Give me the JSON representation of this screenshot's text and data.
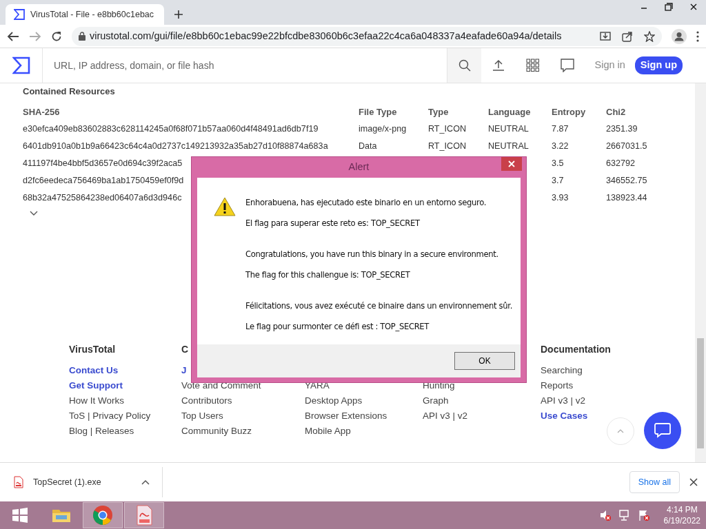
{
  "browser": {
    "tab_title": "VirusTotal - File - e8bb60c1ebac",
    "url": "virustotal.com/gui/file/e8bb60c1ebac99e22bfcdbe83060b6c3efaa22c4ca6a048337a4eafade60a94a/details"
  },
  "site_header": {
    "search_placeholder": "URL, IP address, domain, or file hash",
    "sign_in": "Sign in",
    "sign_up": "Sign up"
  },
  "resources": {
    "title": "Contained Resources",
    "columns": [
      "SHA-256",
      "File Type",
      "Type",
      "Language",
      "Entropy",
      "Chi2"
    ],
    "rows": [
      {
        "sha256": "e30efca409eb83602883c628114245a0f68f071b57aa060d4f48491ad6db7f19",
        "file_type": "image/x-png",
        "type": "RT_ICON",
        "language": "NEUTRAL",
        "entropy": "7.87",
        "chi2": "2351.39"
      },
      {
        "sha256": "6401db910a0b1b9a66423c64c4a0d2737c149213932a35ab27d10f88874a683a",
        "file_type": "Data",
        "type": "RT_ICON",
        "language": "NEUTRAL",
        "entropy": "3.22",
        "chi2": "2667031.5"
      },
      {
        "sha256": "411197f4be4bbf5d3657e0d694c39f2aca5",
        "entropy": "3.5",
        "chi2": "632792"
      },
      {
        "sha256": "d2fc6eedeca756469ba1ab1750459ef0f9d",
        "entropy": "3.7",
        "chi2": "346552.75"
      },
      {
        "sha256": "68b32a47525864238ed06407a6d3d946c",
        "entropy": "3.93",
        "chi2": "138923.44"
      }
    ]
  },
  "dialog": {
    "title": "Alert",
    "messages": [
      "Enhorabuena, has ejecutado este binario en un entorno seguro.",
      "El flag para superar este reto es: TOP_SECRET",
      "Congratulations, you have run this binary in a secure environment.",
      "The flag for this challengue is: TOP_SECRET",
      "Félicitations, vous avez exécuté ce binaire dans un environnement sûr.",
      "Le flag pour surmonter ce défi est : TOP_SECRET"
    ],
    "ok_button": "OK"
  },
  "footer": [
    {
      "heading": "VirusTotal",
      "links": [
        {
          "text": "Contact Us",
          "emphasized": true
        },
        {
          "text": "Get Support",
          "emphasized": true
        },
        {
          "text": "How It Works",
          "emphasized": false
        },
        {
          "text": "ToS | Privacy Policy",
          "emphasized": false
        },
        {
          "text": "Blog | Releases",
          "emphasized": false
        }
      ]
    },
    {
      "heading": "C",
      "links": [
        {
          "text": "J",
          "emphasized": true
        },
        {
          "text": "Vote and Comment",
          "emphasized": false
        },
        {
          "text": "Contributors",
          "emphasized": false
        },
        {
          "text": "Top Users",
          "emphasized": false
        },
        {
          "text": "Community Buzz",
          "emphasized": false
        }
      ]
    },
    {
      "links": [
        {
          "text": "YARA",
          "emphasized": false
        },
        {
          "text": "Desktop Apps",
          "emphasized": false
        },
        {
          "text": "Browser Extensions",
          "emphasized": false
        },
        {
          "text": "Mobile App",
          "emphasized": false
        }
      ]
    },
    {
      "links": [
        {
          "text": "Hunting",
          "emphasized": false
        },
        {
          "text": "Graph",
          "emphasized": false
        },
        {
          "text": "API v3 | v2",
          "emphasized": false
        }
      ]
    },
    {
      "heading": "Documentation",
      "links": [
        {
          "text": "Searching",
          "emphasized": false
        },
        {
          "text": "Reports",
          "emphasized": false
        },
        {
          "text": "API v3 | v2",
          "emphasized": false
        },
        {
          "text": "Use Cases",
          "emphasized": true
        }
      ]
    }
  ],
  "downloads": {
    "file": "TopSecret (1).exe",
    "show_all": "Show all"
  },
  "taskbar": {
    "apps": [
      {
        "kind": "explorer",
        "running": false
      },
      {
        "kind": "chrome",
        "running": true
      },
      {
        "kind": "pdf",
        "running": true
      }
    ],
    "time": "4:14 PM",
    "date": "6/19/2022"
  }
}
